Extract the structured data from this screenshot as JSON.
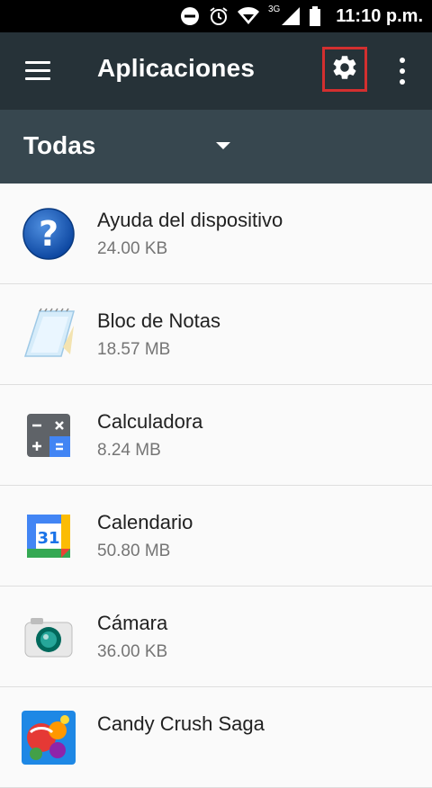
{
  "status_bar": {
    "network": "3G",
    "time": "11:10 p.m."
  },
  "toolbar": {
    "title": "Aplicaciones",
    "menu_icon": "hamburger-menu-icon",
    "settings_icon": "gear-icon",
    "overflow_icon": "more-vert-icon",
    "highlight_color": "#d32f2f"
  },
  "filter": {
    "selected": "Todas"
  },
  "apps": [
    {
      "name": "Ayuda del dispositivo",
      "size": "24.00 KB",
      "icon": "help-icon"
    },
    {
      "name": "Bloc de Notas",
      "size": "18.57 MB",
      "icon": "notepad-icon"
    },
    {
      "name": "Calculadora",
      "size": "8.24 MB",
      "icon": "calculator-icon"
    },
    {
      "name": "Calendario",
      "size": "50.80 MB",
      "icon": "calendar-icon"
    },
    {
      "name": "Cámara",
      "size": "36.00 KB",
      "icon": "camera-icon"
    },
    {
      "name": "Candy Crush Saga",
      "size": "",
      "icon": "candy-crush-icon"
    }
  ],
  "colors": {
    "toolbar_bg": "#263238",
    "filter_bg": "#37474f",
    "list_bg": "#fafafa"
  }
}
